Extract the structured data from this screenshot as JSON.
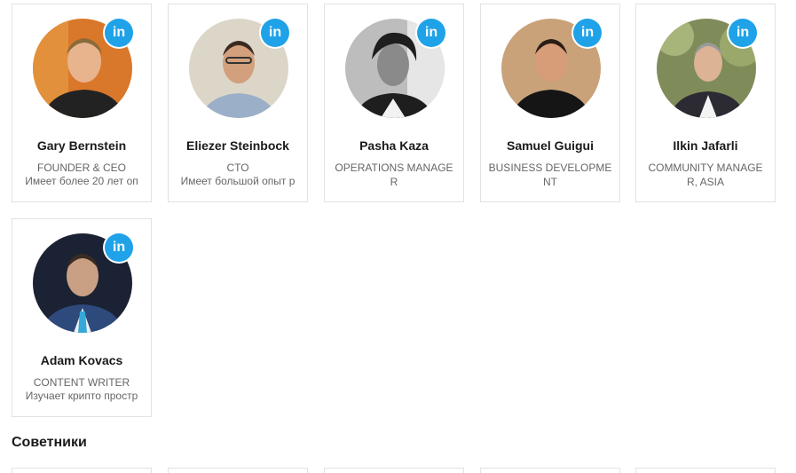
{
  "team": [
    {
      "name": "Gary Bernstein",
      "role": "FOUNDER & CEO",
      "description": "Имеет более 20 лет оп",
      "social": "in",
      "photo_bg": "#d9772a",
      "photo_fg": "#222222"
    },
    {
      "name": "Eliezer Steinbock",
      "role": "CTO",
      "description": "Имеет большой опыт р",
      "social": "in",
      "photo_bg": "#dcd6c8",
      "photo_fg": "#9bb0c8"
    },
    {
      "name": "Pasha Kaza",
      "role": "OPERATIONS MANAGER",
      "description": "",
      "social": "in",
      "photo_bg": "#bdbdbd",
      "photo_fg": "#1e1e1e"
    },
    {
      "name": "Samuel Guigui",
      "role": "BUSINESS DEVELOPMENT",
      "description": "",
      "social": "in",
      "photo_bg": "#c9a27a",
      "photo_fg": "#151515"
    },
    {
      "name": "Ilkin Jafarli",
      "role": "COMMUNITY MANAGER, ASIA",
      "description": "",
      "social": "in",
      "photo_bg": "#7f8c5a",
      "photo_fg": "#2c2a33"
    },
    {
      "name": "Adam Kovacs",
      "role": "CONTENT WRITER",
      "description": "Изучает крипто простр",
      "social": "in",
      "photo_bg": "#1b2233",
      "photo_fg": "#2e4a7c"
    }
  ],
  "advisors_title": "Советники",
  "colors": {
    "linkedin": "#1fa2e8",
    "card_border": "#e2e2e2"
  }
}
